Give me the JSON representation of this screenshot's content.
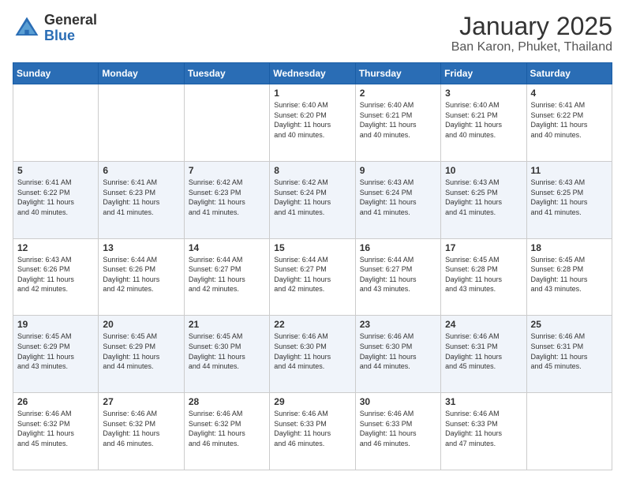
{
  "header": {
    "logo_general": "General",
    "logo_blue": "Blue",
    "title": "January 2025",
    "subtitle": "Ban Karon, Phuket, Thailand"
  },
  "days_of_week": [
    "Sunday",
    "Monday",
    "Tuesday",
    "Wednesday",
    "Thursday",
    "Friday",
    "Saturday"
  ],
  "weeks": [
    [
      {
        "day": "",
        "info": ""
      },
      {
        "day": "",
        "info": ""
      },
      {
        "day": "",
        "info": ""
      },
      {
        "day": "1",
        "info": "Sunrise: 6:40 AM\nSunset: 6:20 PM\nDaylight: 11 hours\nand 40 minutes."
      },
      {
        "day": "2",
        "info": "Sunrise: 6:40 AM\nSunset: 6:21 PM\nDaylight: 11 hours\nand 40 minutes."
      },
      {
        "day": "3",
        "info": "Sunrise: 6:40 AM\nSunset: 6:21 PM\nDaylight: 11 hours\nand 40 minutes."
      },
      {
        "day": "4",
        "info": "Sunrise: 6:41 AM\nSunset: 6:22 PM\nDaylight: 11 hours\nand 40 minutes."
      }
    ],
    [
      {
        "day": "5",
        "info": "Sunrise: 6:41 AM\nSunset: 6:22 PM\nDaylight: 11 hours\nand 40 minutes."
      },
      {
        "day": "6",
        "info": "Sunrise: 6:41 AM\nSunset: 6:23 PM\nDaylight: 11 hours\nand 41 minutes."
      },
      {
        "day": "7",
        "info": "Sunrise: 6:42 AM\nSunset: 6:23 PM\nDaylight: 11 hours\nand 41 minutes."
      },
      {
        "day": "8",
        "info": "Sunrise: 6:42 AM\nSunset: 6:24 PM\nDaylight: 11 hours\nand 41 minutes."
      },
      {
        "day": "9",
        "info": "Sunrise: 6:43 AM\nSunset: 6:24 PM\nDaylight: 11 hours\nand 41 minutes."
      },
      {
        "day": "10",
        "info": "Sunrise: 6:43 AM\nSunset: 6:25 PM\nDaylight: 11 hours\nand 41 minutes."
      },
      {
        "day": "11",
        "info": "Sunrise: 6:43 AM\nSunset: 6:25 PM\nDaylight: 11 hours\nand 41 minutes."
      }
    ],
    [
      {
        "day": "12",
        "info": "Sunrise: 6:43 AM\nSunset: 6:26 PM\nDaylight: 11 hours\nand 42 minutes."
      },
      {
        "day": "13",
        "info": "Sunrise: 6:44 AM\nSunset: 6:26 PM\nDaylight: 11 hours\nand 42 minutes."
      },
      {
        "day": "14",
        "info": "Sunrise: 6:44 AM\nSunset: 6:27 PM\nDaylight: 11 hours\nand 42 minutes."
      },
      {
        "day": "15",
        "info": "Sunrise: 6:44 AM\nSunset: 6:27 PM\nDaylight: 11 hours\nand 42 minutes."
      },
      {
        "day": "16",
        "info": "Sunrise: 6:44 AM\nSunset: 6:27 PM\nDaylight: 11 hours\nand 43 minutes."
      },
      {
        "day": "17",
        "info": "Sunrise: 6:45 AM\nSunset: 6:28 PM\nDaylight: 11 hours\nand 43 minutes."
      },
      {
        "day": "18",
        "info": "Sunrise: 6:45 AM\nSunset: 6:28 PM\nDaylight: 11 hours\nand 43 minutes."
      }
    ],
    [
      {
        "day": "19",
        "info": "Sunrise: 6:45 AM\nSunset: 6:29 PM\nDaylight: 11 hours\nand 43 minutes."
      },
      {
        "day": "20",
        "info": "Sunrise: 6:45 AM\nSunset: 6:29 PM\nDaylight: 11 hours\nand 44 minutes."
      },
      {
        "day": "21",
        "info": "Sunrise: 6:45 AM\nSunset: 6:30 PM\nDaylight: 11 hours\nand 44 minutes."
      },
      {
        "day": "22",
        "info": "Sunrise: 6:46 AM\nSunset: 6:30 PM\nDaylight: 11 hours\nand 44 minutes."
      },
      {
        "day": "23",
        "info": "Sunrise: 6:46 AM\nSunset: 6:30 PM\nDaylight: 11 hours\nand 44 minutes."
      },
      {
        "day": "24",
        "info": "Sunrise: 6:46 AM\nSunset: 6:31 PM\nDaylight: 11 hours\nand 45 minutes."
      },
      {
        "day": "25",
        "info": "Sunrise: 6:46 AM\nSunset: 6:31 PM\nDaylight: 11 hours\nand 45 minutes."
      }
    ],
    [
      {
        "day": "26",
        "info": "Sunrise: 6:46 AM\nSunset: 6:32 PM\nDaylight: 11 hours\nand 45 minutes."
      },
      {
        "day": "27",
        "info": "Sunrise: 6:46 AM\nSunset: 6:32 PM\nDaylight: 11 hours\nand 46 minutes."
      },
      {
        "day": "28",
        "info": "Sunrise: 6:46 AM\nSunset: 6:32 PM\nDaylight: 11 hours\nand 46 minutes."
      },
      {
        "day": "29",
        "info": "Sunrise: 6:46 AM\nSunset: 6:33 PM\nDaylight: 11 hours\nand 46 minutes."
      },
      {
        "day": "30",
        "info": "Sunrise: 6:46 AM\nSunset: 6:33 PM\nDaylight: 11 hours\nand 46 minutes."
      },
      {
        "day": "31",
        "info": "Sunrise: 6:46 AM\nSunset: 6:33 PM\nDaylight: 11 hours\nand 47 minutes."
      },
      {
        "day": "",
        "info": ""
      }
    ]
  ],
  "colors": {
    "header_bg": "#2a6db5",
    "header_text": "#ffffff",
    "accent": "#2a6db5"
  }
}
